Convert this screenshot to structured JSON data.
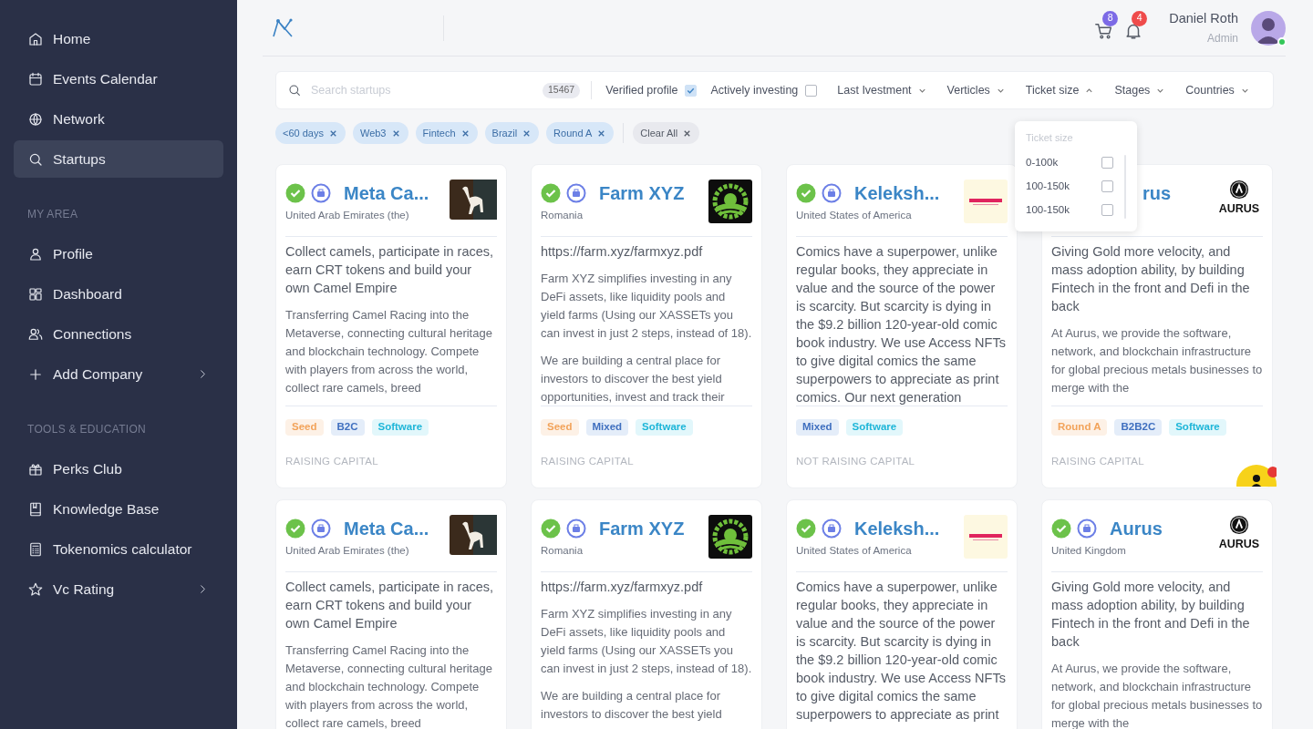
{
  "sidebar": {
    "sections": [
      {
        "items": [
          {
            "label": "Home",
            "selected": false
          },
          {
            "label": "Events Calendar",
            "selected": false
          },
          {
            "label": "Network",
            "selected": false
          },
          {
            "label": "Startups",
            "selected": true
          }
        ]
      },
      {
        "heading": "MY AREA",
        "items": [
          {
            "label": "Profile",
            "selected": false
          },
          {
            "label": "Dashboard",
            "selected": false
          },
          {
            "label": "Connections",
            "selected": false
          },
          {
            "label": "Add Company",
            "selected": false,
            "has_submenu": true
          }
        ]
      },
      {
        "heading": "TOOLS & EDUCATION",
        "items": [
          {
            "label": "Perks Club",
            "selected": false
          },
          {
            "label": "Knowledge Base",
            "selected": false
          },
          {
            "label": "Tokenomics calculator",
            "selected": false
          },
          {
            "label": "Vc Rating",
            "selected": false,
            "has_submenu": true
          }
        ]
      }
    ]
  },
  "header": {
    "cart_count": "8",
    "notification_count": "4",
    "user": {
      "name": "Daniel Roth",
      "role": "Admin",
      "online": true
    }
  },
  "filters": {
    "search": {
      "placeholder": "Search startups",
      "count": "15467"
    },
    "toggles": [
      {
        "label": "Verified profile",
        "checked": true
      },
      {
        "label": "Actively investing",
        "checked": false
      }
    ],
    "dropdowns": [
      {
        "label": "Last Ivestment",
        "expanded": false
      },
      {
        "label": "Verticles",
        "expanded": false
      },
      {
        "label": "Ticket size",
        "expanded": true
      },
      {
        "label": "Stages",
        "expanded": false
      },
      {
        "label": "Countries",
        "expanded": false
      }
    ],
    "chips": [
      "<60 days",
      "Web3",
      "Fintech",
      "Brazil",
      "Round A"
    ],
    "clear_all": "Clear All"
  },
  "ticket_menu": {
    "title": "Ticket size",
    "options": [
      {
        "label": "0-100k",
        "checked": false
      },
      {
        "label": "100-150k",
        "checked": false
      },
      {
        "label": "100-150k",
        "checked": false
      }
    ]
  },
  "cards": [
    {
      "name": "Meta Ca...",
      "country": "United Arab Emirates (the)",
      "logo": {
        "kind": "camel"
      },
      "summary": "Collect camels, participate in races, earn CRT tokens and build your own Camel Empire",
      "paragraphs": [
        "Transferring Camel Racing into the Metaverse, connecting cultural heritage and blockchain technology. Compete with players from across the world, collect rare camels, breed"
      ],
      "tags": [
        {
          "label": "Seed",
          "kind": "stage"
        },
        {
          "label": "B2C",
          "kind": "model"
        },
        {
          "label": "Software",
          "kind": "vertical"
        }
      ],
      "status": "RAISING CAPITAL"
    },
    {
      "name": "Farm XYZ",
      "country": "Romania",
      "logo": {
        "kind": "farm"
      },
      "summary": "https://farm.xyz/farmxyz.pdf",
      "paragraphs": [
        "Farm XYZ simplifies investing in any DeFi assets, like liquidity pools and yield farms (Using our XASSETs you can invest in just 2 steps, instead of 18).",
        "We are building a central place for investors to discover the best yield opportunities, invest and track their"
      ],
      "tags": [
        {
          "label": "Seed",
          "kind": "stage"
        },
        {
          "label": "Mixed",
          "kind": "model"
        },
        {
          "label": "Software",
          "kind": "vertical"
        }
      ],
      "status": "RAISING CAPITAL"
    },
    {
      "name": "Keleksh...",
      "country": "United States of America",
      "logo": {
        "kind": "kelekshen"
      },
      "summary": "Comics have a superpower, unlike regular books, they appreciate in value and the source of the power is scarcity. But scarcity is dying in the $9.2 billion 120-year-old comic book industry. We use Access NFTs to give digital comics the same superpowers to appreciate as print comics. Our next generation",
      "tags": [
        {
          "label": "Mixed",
          "kind": "model"
        },
        {
          "label": "Software",
          "kind": "vertical"
        }
      ],
      "status": "NOT RAISING CAPITAL"
    },
    {
      "name": "rus",
      "name_covered": true,
      "logo": {
        "kind": "aurus",
        "text": "AURUS"
      },
      "summary": "Giving Gold more velocity, and mass adoption ability, by building Fintech in the front and Defi in the back",
      "paragraphs": [
        "At Aurus, we provide the software, network, and blockchain infrastructure for global precious metals businesses to merge with the"
      ],
      "tags": [
        {
          "label": "Round A",
          "kind": "stage"
        },
        {
          "label": "B2B2C",
          "kind": "model"
        },
        {
          "label": "Software",
          "kind": "vertical"
        }
      ],
      "status": "RAISING CAPITAL"
    },
    {
      "name": "Meta Ca...",
      "country": "United Arab Emirates (the)",
      "logo": {
        "kind": "camel"
      },
      "summary": "Collect camels, participate in races, earn CRT tokens and build your own Camel Empire",
      "paragraphs": [
        "Transferring Camel Racing into the Metaverse, connecting cultural heritage and blockchain technology. Compete with players from across the world, collect rare camels, breed"
      ]
    },
    {
      "name": "Farm XYZ",
      "country": "Romania",
      "logo": {
        "kind": "farm"
      },
      "summary": "https://farm.xyz/farmxyz.pdf",
      "paragraphs": [
        "Farm XYZ simplifies investing in any DeFi assets, like liquidity pools and yield farms (Using our XASSETs you can invest in just 2 steps, instead of 18).",
        "We are building a central place for investors to discover the best yield"
      ]
    },
    {
      "name": "Keleksh...",
      "country": "United States of America",
      "logo": {
        "kind": "kelekshen"
      },
      "summary": "Comics have a superpower, unlike regular books, they appreciate in value and the source of the power is scarcity. But scarcity is dying in the $9.2 billion 120-year-old comic book industry. We use Access NFTs to give digital comics the same superpowers to appreciate as print"
    },
    {
      "name": "Aurus",
      "country": "United Kingdom",
      "logo": {
        "kind": "aurus",
        "text": "AURUS"
      },
      "summary": "Giving Gold more velocity, and mass adoption ability, by building Fintech in the front and Defi in the back",
      "paragraphs": [
        "At Aurus, we provide the software, network, and blockchain infrastructure for global precious metals businesses to merge with the"
      ]
    }
  ]
}
